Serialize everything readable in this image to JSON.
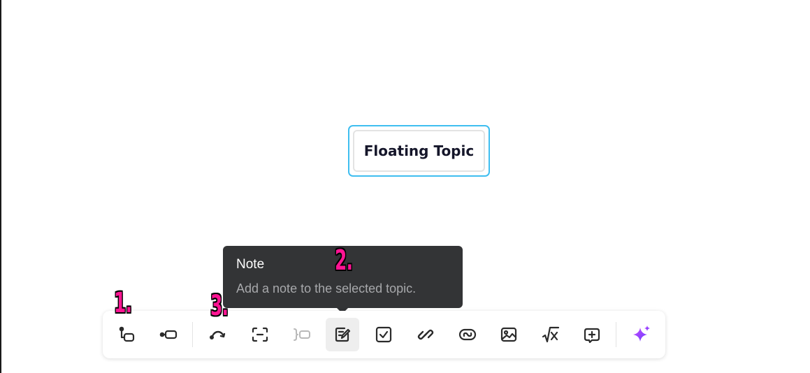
{
  "canvas": {
    "floating_topic": {
      "label": "Floating Topic"
    }
  },
  "tooltip": {
    "title": "Note",
    "description": "Add a note to the selected topic."
  },
  "annotations": [
    "1.",
    "2.",
    "3."
  ],
  "toolbar": {
    "items": [
      {
        "name": "subtopic",
        "icon": "subtopic-icon"
      },
      {
        "name": "topic-after",
        "icon": "topic-after-icon"
      },
      {
        "name": "relationship",
        "icon": "relationship-icon"
      },
      {
        "name": "boundary",
        "icon": "boundary-icon"
      },
      {
        "name": "summary",
        "icon": "summary-icon",
        "disabled": true
      },
      {
        "name": "note",
        "icon": "note-icon",
        "active": true
      },
      {
        "name": "task",
        "icon": "checkbox-icon"
      },
      {
        "name": "hyperlink",
        "icon": "link-icon"
      },
      {
        "name": "topic-link",
        "icon": "topic-link-icon"
      },
      {
        "name": "image",
        "icon": "image-icon"
      },
      {
        "name": "equation",
        "icon": "equation-icon"
      },
      {
        "name": "insert-more",
        "icon": "add-box-icon"
      },
      {
        "name": "ai",
        "icon": "ai-sparkle-icon"
      }
    ],
    "colors": {
      "icon": "#2b2b2b",
      "disabled": "#b8b8b8",
      "ai_start": "#c64bff",
      "ai_end": "#6b3dff"
    }
  }
}
